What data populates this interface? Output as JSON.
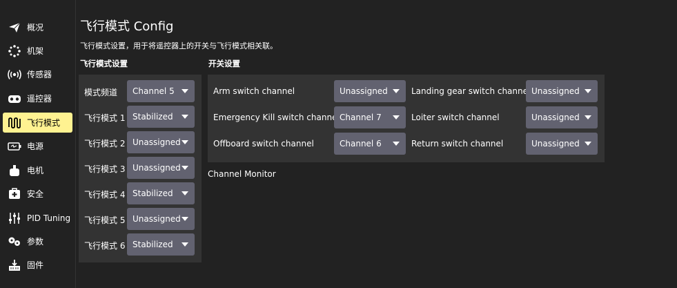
{
  "sidebar": {
    "items": [
      {
        "label": "概况",
        "icon": "paper-plane-icon"
      },
      {
        "label": "机架",
        "icon": "airframe-icon"
      },
      {
        "label": "传感器",
        "icon": "radio-waves-icon"
      },
      {
        "label": "遥控器",
        "icon": "gamepad-icon"
      },
      {
        "label": "飞行模式",
        "icon": "flight-modes-icon",
        "active": true
      },
      {
        "label": "电源",
        "icon": "battery-icon"
      },
      {
        "label": "电机",
        "icon": "motor-icon"
      },
      {
        "label": "安全",
        "icon": "medkit-icon"
      },
      {
        "label": "PID Tuning",
        "icon": "sliders-icon"
      },
      {
        "label": "参数",
        "icon": "gears-icon"
      },
      {
        "label": "固件",
        "icon": "firmware-icon"
      }
    ],
    "active_color": "#fff291"
  },
  "header": {
    "title": "飞行模式 Config",
    "description": "飞行模式设置，用于将遥控器上的开关与飞行模式相关联。"
  },
  "flight_modes": {
    "title": "飞行模式设置",
    "rows": [
      {
        "label": "模式频道",
        "value": "Channel 5"
      },
      {
        "label": "飞行模式 1",
        "value": "Stabilized"
      },
      {
        "label": "飞行模式 2",
        "value": "Unassigned"
      },
      {
        "label": "飞行模式 3",
        "value": "Unassigned"
      },
      {
        "label": "飞行模式 4",
        "value": "Stabilized"
      },
      {
        "label": "飞行模式 5",
        "value": "Unassigned"
      },
      {
        "label": "飞行模式 6",
        "value": "Stabilized"
      }
    ]
  },
  "switches": {
    "title": "开关设置",
    "left": [
      {
        "label": "Arm switch channel",
        "value": "Unassigned"
      },
      {
        "label": "Emergency Kill switch channel",
        "value": "Channel 7"
      },
      {
        "label": "Offboard switch channel",
        "value": "Channel 6"
      }
    ],
    "right": [
      {
        "label": "Landing gear switch channel",
        "value": "Unassigned"
      },
      {
        "label": "Loiter switch channel",
        "value": "Unassigned"
      },
      {
        "label": "Return switch channel",
        "value": "Unassigned"
      }
    ]
  },
  "channel_monitor": {
    "label": "Channel Monitor"
  }
}
